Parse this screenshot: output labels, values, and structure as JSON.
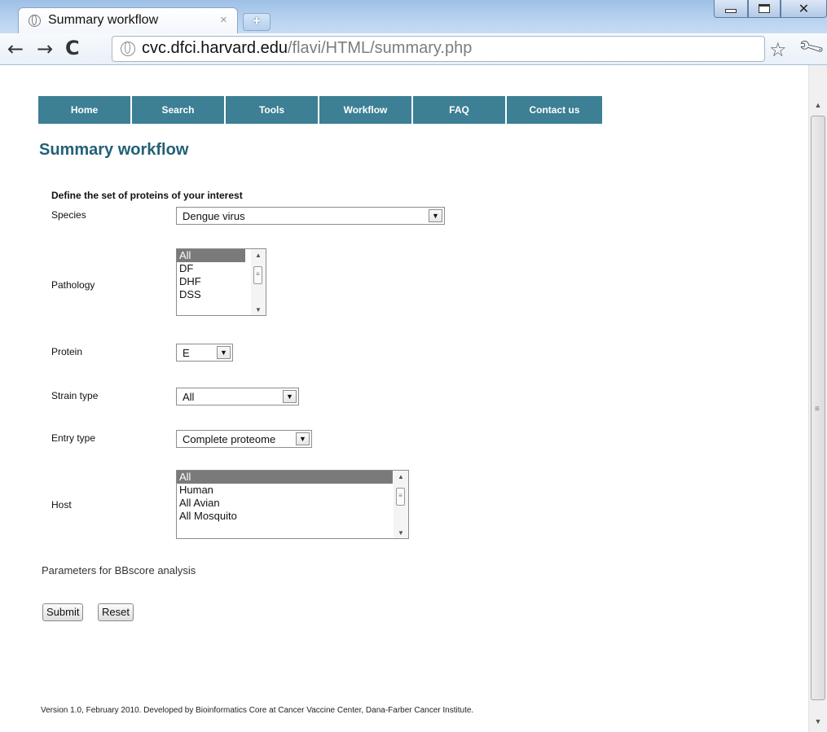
{
  "browser": {
    "tab_title": "Summary workflow",
    "tab_close": "×",
    "new_tab": "+",
    "url_host": "cvc.dfci.harvard.edu",
    "url_path": "/flavi/HTML/summary.php"
  },
  "nav": {
    "items": [
      "Home",
      "Search",
      "Tools",
      "Workflow",
      "FAQ",
      "Contact us"
    ]
  },
  "page": {
    "title": "Summary workflow",
    "section_title": "Define the set of proteins of your interest",
    "fields": {
      "species": {
        "label": "Species",
        "value": "Dengue virus"
      },
      "pathology": {
        "label": "Pathology",
        "options": [
          "All",
          "DF",
          "DHF",
          "DSS"
        ],
        "selected": "All"
      },
      "protein": {
        "label": "Protein",
        "value": "E"
      },
      "strain_type": {
        "label": "Strain type",
        "value": "All"
      },
      "entry_type": {
        "label": "Entry type",
        "value": "Complete proteome"
      },
      "host": {
        "label": "Host",
        "options": [
          "All",
          "Human",
          "All Avian",
          "All Mosquito"
        ],
        "selected": "All"
      }
    },
    "params_text": "Parameters for BBscore analysis",
    "submit_label": "Submit",
    "reset_label": "Reset",
    "footer": "Version 1.0, February 2010. Developed by Bioinformatics Core at Cancer Vaccine Center, Dana-Farber Cancer Institute."
  }
}
